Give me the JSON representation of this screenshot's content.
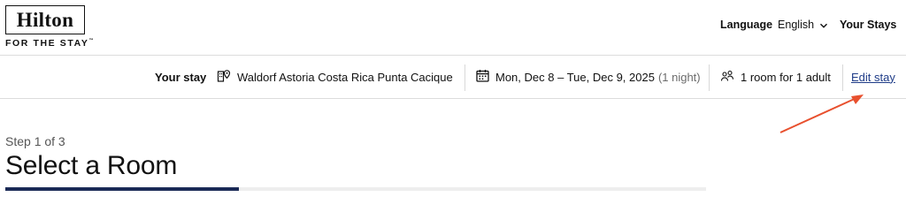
{
  "brand": {
    "name": "Hilton",
    "tagline": "FOR THE STAY",
    "trademark": "™"
  },
  "header": {
    "language_label": "Language",
    "language_value": "English",
    "your_stays": "Your Stays",
    "icons": {
      "language_dropdown": "chevron-down-icon"
    }
  },
  "stay_summary": {
    "label": "Your stay",
    "hotel": "Waldorf Astoria Costa Rica Punta Cacique",
    "dates": "Mon, Dec 8 – Tue, Dec 9, 2025",
    "nights": "(1 night)",
    "occupancy": "1 room for 1 adult",
    "edit_label": "Edit stay",
    "icons": {
      "hotel": "hotel-location-icon",
      "dates": "calendar-icon",
      "occupancy": "guests-icon"
    }
  },
  "annotation": {
    "type": "arrow",
    "color": "#e8502e",
    "points_to": "edit-stay-link"
  },
  "booking": {
    "step_text": "Step 1 of 3",
    "title": "Select a Room",
    "progress": 0.333
  },
  "colors": {
    "link": "#1f3c88",
    "progress_fill": "#1b2a56",
    "annotation_arrow": "#e8502e"
  }
}
